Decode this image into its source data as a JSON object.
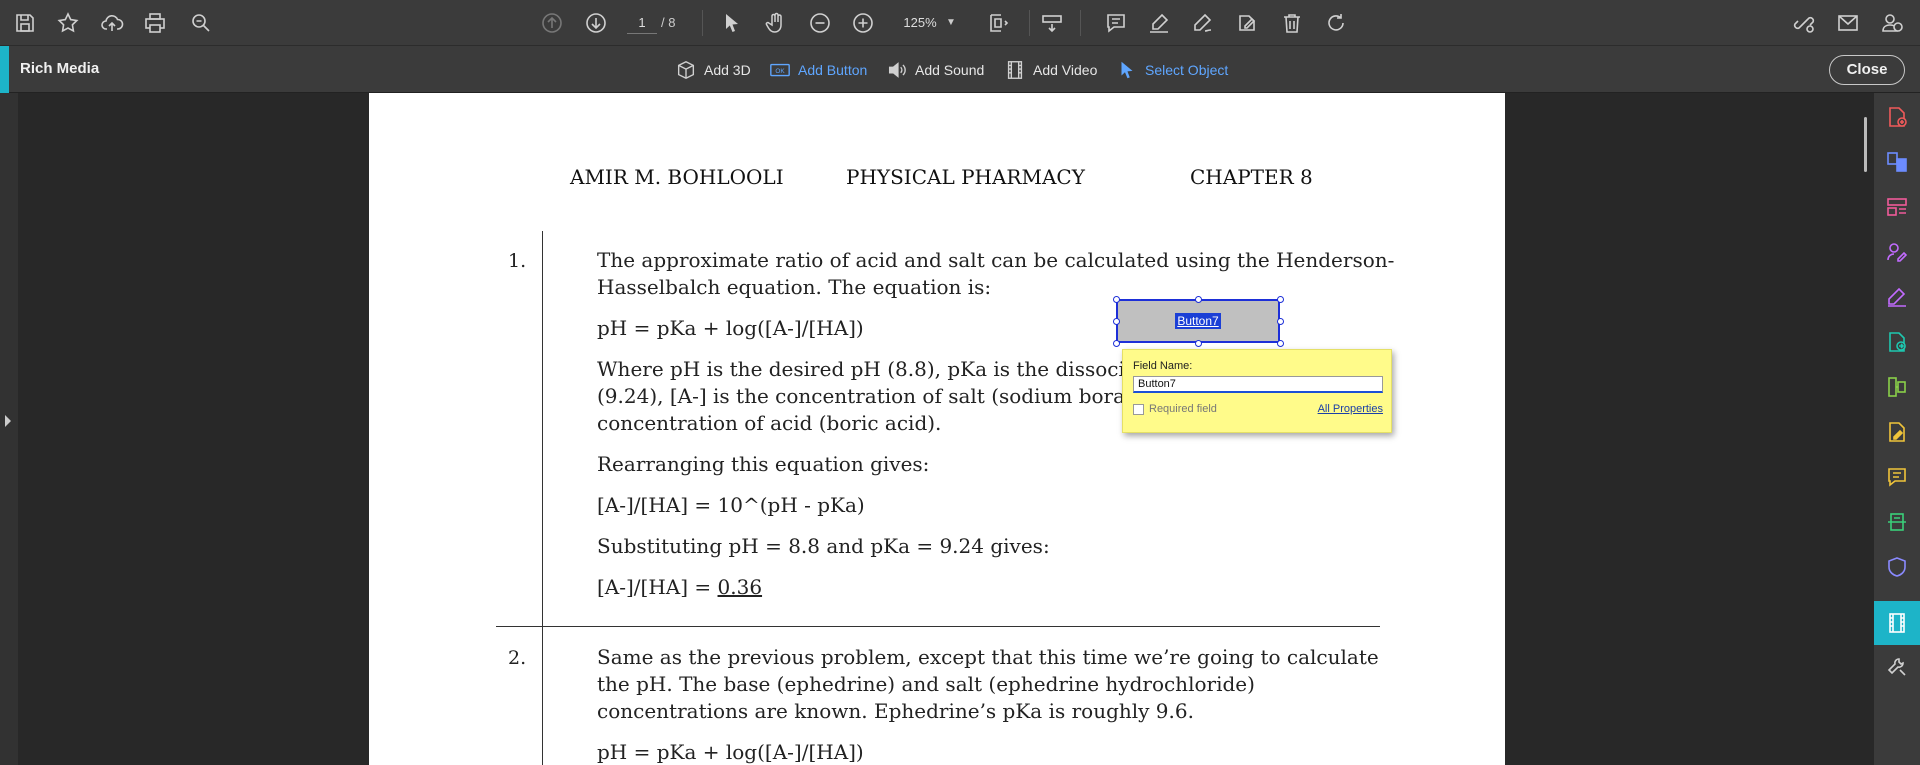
{
  "toolbar": {
    "page_current": "1",
    "page_total": "/ 8",
    "zoom": "125%"
  },
  "rich_media": {
    "title": "Rich Media",
    "tools": [
      {
        "label": "Add 3D"
      },
      {
        "label": "Add Button"
      },
      {
        "label": "Add Sound"
      },
      {
        "label": "Add Video"
      },
      {
        "label": "Select Object"
      }
    ],
    "close_label": "Close",
    "accent_color": "#1db4c8",
    "active_color": "#5fa6ff"
  },
  "document": {
    "header": {
      "author": "AMIR M. BOHLOOLI",
      "subject": "PHYSICAL PHARMACY",
      "chapter": "CHAPTER 8"
    },
    "problem1": {
      "number": "1.",
      "line1": "The approximate ratio of acid and salt can be calculated using the Henderson-",
      "line2": "Hasselbalch equation. The equation is:",
      "eq1": "pH = pKa + log([A-]/[HA])",
      "where1": "Where pH is the desired pH (8.8), pKa is the dissociati",
      "where2": "(9.24), [A-] is the concentration of salt (sodium borate",
      "where3": "concentration of acid (boric acid).",
      "rearr": "Rearranging this equation gives:",
      "eq2": "[A-]/[HA] = 10^(pH - pKa)",
      "subst": "Substituting pH = 8.8 and pKa = 9.24 gives:",
      "result_prefix": "[A-]/[HA] = ",
      "result_value": "0.36"
    },
    "problem2": {
      "number": "2.",
      "line1": "Same as the previous problem, except that this time we’re going to calculate",
      "line2": "the pH. The base (ephedrine) and salt (ephedrine hydrochloride)",
      "line3": "concentrations are known. Ephedrine’s pKa is roughly 9.6.",
      "eq1": "pH = pKa + log([A-]/[HA])"
    }
  },
  "form_field": {
    "button_label": "Button7",
    "popup": {
      "field_name_label": "Field Name:",
      "field_name_value": "Button7",
      "required_label": "Required field",
      "all_properties": "All Properties"
    }
  },
  "right_pane": {
    "icons": [
      "create-pdf-icon",
      "combine-files-icon",
      "organize-pages-icon",
      "request-signature-icon",
      "fill-sign-icon",
      "export-pdf-icon",
      "compress-pdf-icon",
      "edit-pdf-icon",
      "comment-icon",
      "scan-ocr-icon",
      "protect-icon",
      "rich-media-icon",
      "more-tools-icon"
    ]
  }
}
